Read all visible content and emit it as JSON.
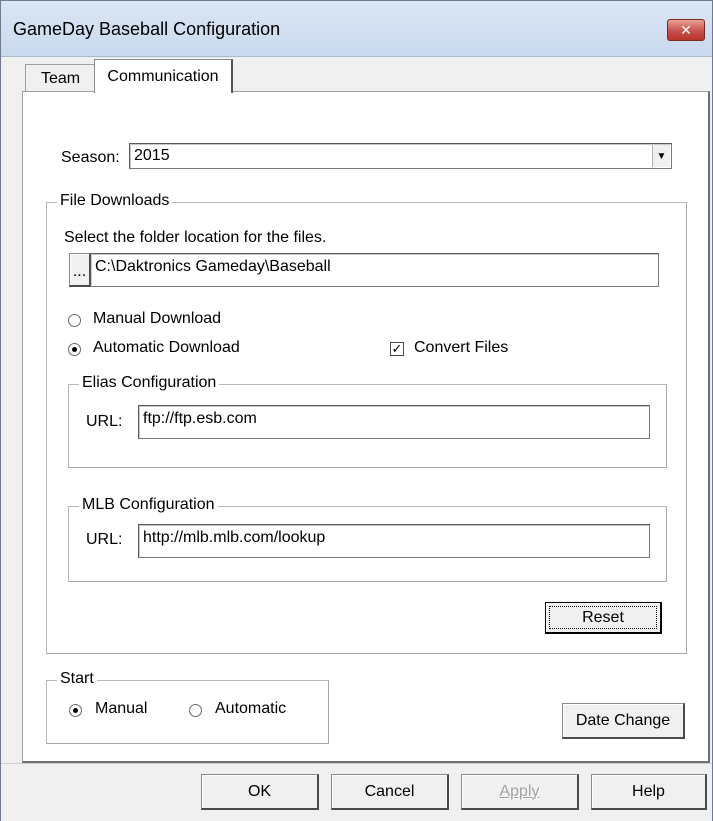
{
  "window": {
    "title": "GameDay Baseball Configuration",
    "close_glyph": "✕"
  },
  "tabs": [
    {
      "label": "Team",
      "active": false
    },
    {
      "label": "Communication",
      "active": true
    }
  ],
  "season": {
    "label": "Season:",
    "value": "2015",
    "dropdown_glyph": "▼"
  },
  "file_downloads": {
    "title": "File Downloads",
    "folder_prompt": "Select the folder location for the files.",
    "browse_label": "...",
    "folder_path": "C:\\Daktronics Gameday\\Baseball",
    "manual_download_label": "Manual Download",
    "manual_download_checked": false,
    "automatic_download_label": "Automatic Download",
    "automatic_download_checked": true,
    "convert_files_label": "Convert Files",
    "convert_files_checked": true,
    "check_glyph": "✓"
  },
  "elias": {
    "title": "Elias Configuration",
    "url_label": "URL:",
    "url_value": "ftp://ftp.esb.com"
  },
  "mlb": {
    "title": "MLB Configuration",
    "url_label": "URL:",
    "url_value": "http://mlb.mlb.com/lookup"
  },
  "reset_label": "Reset",
  "start": {
    "title": "Start",
    "manual_label": "Manual",
    "manual_checked": true,
    "automatic_label": "Automatic",
    "automatic_checked": false
  },
  "date_change_label": "Date Change",
  "footer": {
    "ok_label": "OK",
    "cancel_label": "Cancel",
    "apply_label": "Apply",
    "apply_enabled": false,
    "help_label": "Help"
  }
}
